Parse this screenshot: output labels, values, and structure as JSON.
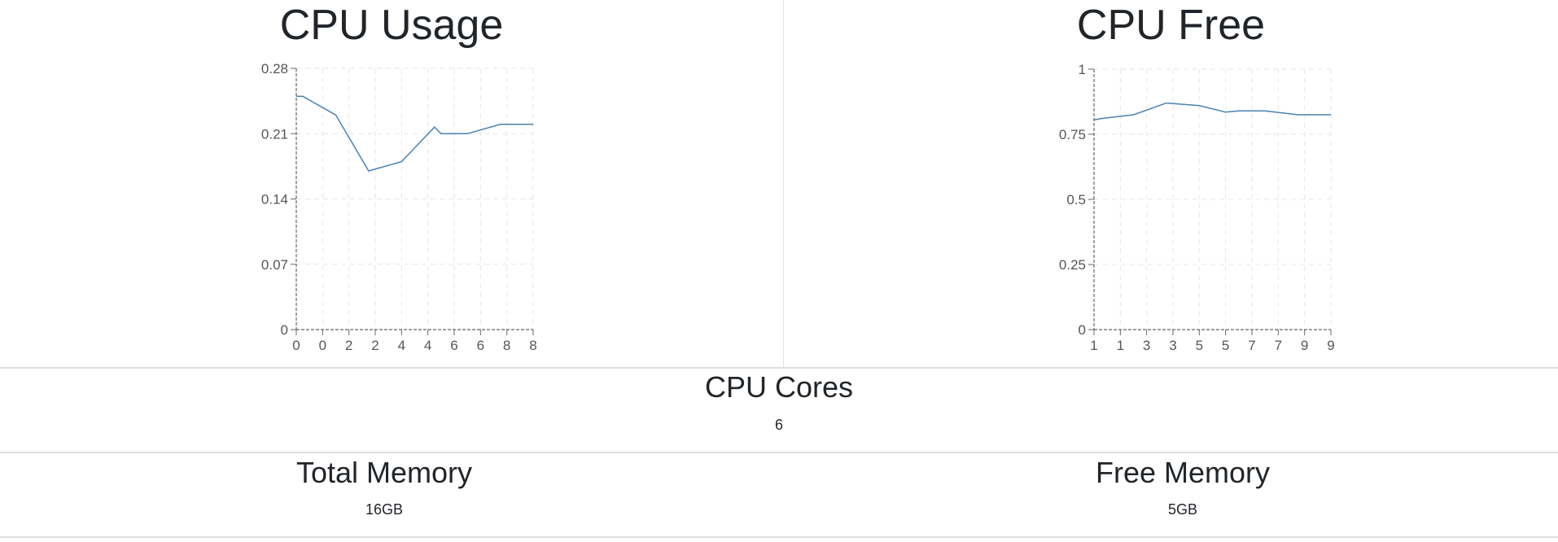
{
  "chart_data": [
    {
      "type": "line",
      "title": "CPU Usage",
      "x_tick_labels": [
        "0",
        "0",
        "2",
        "2",
        "4",
        "4",
        "6",
        "6",
        "8",
        "8"
      ],
      "y_ticks": [
        0,
        0.07,
        0.14,
        0.21,
        0.28
      ],
      "ylim": [
        0,
        0.28
      ],
      "xlim": [
        0,
        9
      ],
      "grid": true,
      "line_color": "#4682b4",
      "x": [
        0,
        0.25,
        1.5,
        2.75,
        4,
        5.25,
        5.5,
        6.5,
        7.75,
        9
      ],
      "y": [
        0.25,
        0.25,
        0.23,
        0.17,
        0.18,
        0.217,
        0.21,
        0.21,
        0.22,
        0.22
      ]
    },
    {
      "type": "line",
      "title": "CPU Free",
      "x_tick_labels": [
        "1",
        "1",
        "3",
        "3",
        "5",
        "5",
        "7",
        "7",
        "9",
        "9"
      ],
      "y_ticks": [
        0,
        0.25,
        0.5,
        0.75,
        1
      ],
      "ylim": [
        0,
        1
      ],
      "xlim": [
        0,
        9
      ],
      "grid": true,
      "line_color": "#4682b4",
      "x": [
        0,
        0.25,
        1.5,
        2.75,
        4,
        5,
        5.5,
        6.5,
        7.75,
        9
      ],
      "y": [
        0.805,
        0.81,
        0.825,
        0.87,
        0.86,
        0.835,
        0.84,
        0.84,
        0.825,
        0.825
      ]
    }
  ],
  "cores": {
    "title": "CPU Cores",
    "value": "6"
  },
  "memory": {
    "total_title": "Total Memory",
    "total_value": "16GB",
    "free_title": "Free Memory",
    "free_value": "5GB"
  }
}
